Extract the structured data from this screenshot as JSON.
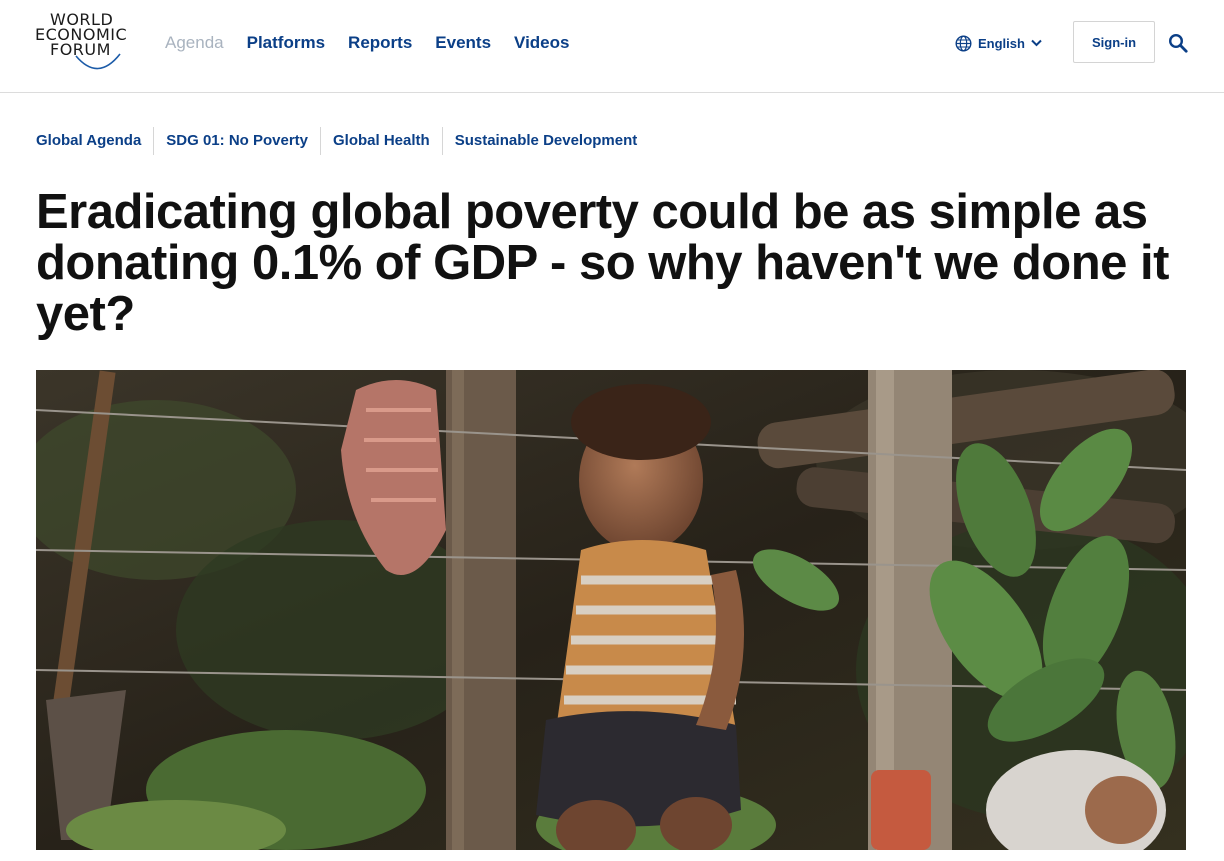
{
  "header": {
    "logo": {
      "line1": "WORLD",
      "line2": "ECONOMIC",
      "line3": "FORUM"
    },
    "nav": [
      {
        "label": "Agenda",
        "active": true
      },
      {
        "label": "Platforms"
      },
      {
        "label": "Reports"
      },
      {
        "label": "Events"
      },
      {
        "label": "Videos"
      }
    ],
    "language": {
      "label": "English",
      "icon": "globe-icon"
    },
    "signin_label": "Sign-in",
    "search_icon": "search-icon"
  },
  "article": {
    "tags": [
      "Global Agenda",
      "SDG 01: No Poverty",
      "Global Health",
      "Sustainable Development"
    ],
    "title": "Eradicating global poverty could be as simple as donating 0.1% of GDP - so why haven't we done it yet?",
    "hero_image": {
      "subject": "child sitting by barbed wire fence among leaves"
    }
  },
  "colors": {
    "brand_blue": "#0b3f87",
    "muted_nav": "#a9b3bf",
    "text": "#111111"
  }
}
